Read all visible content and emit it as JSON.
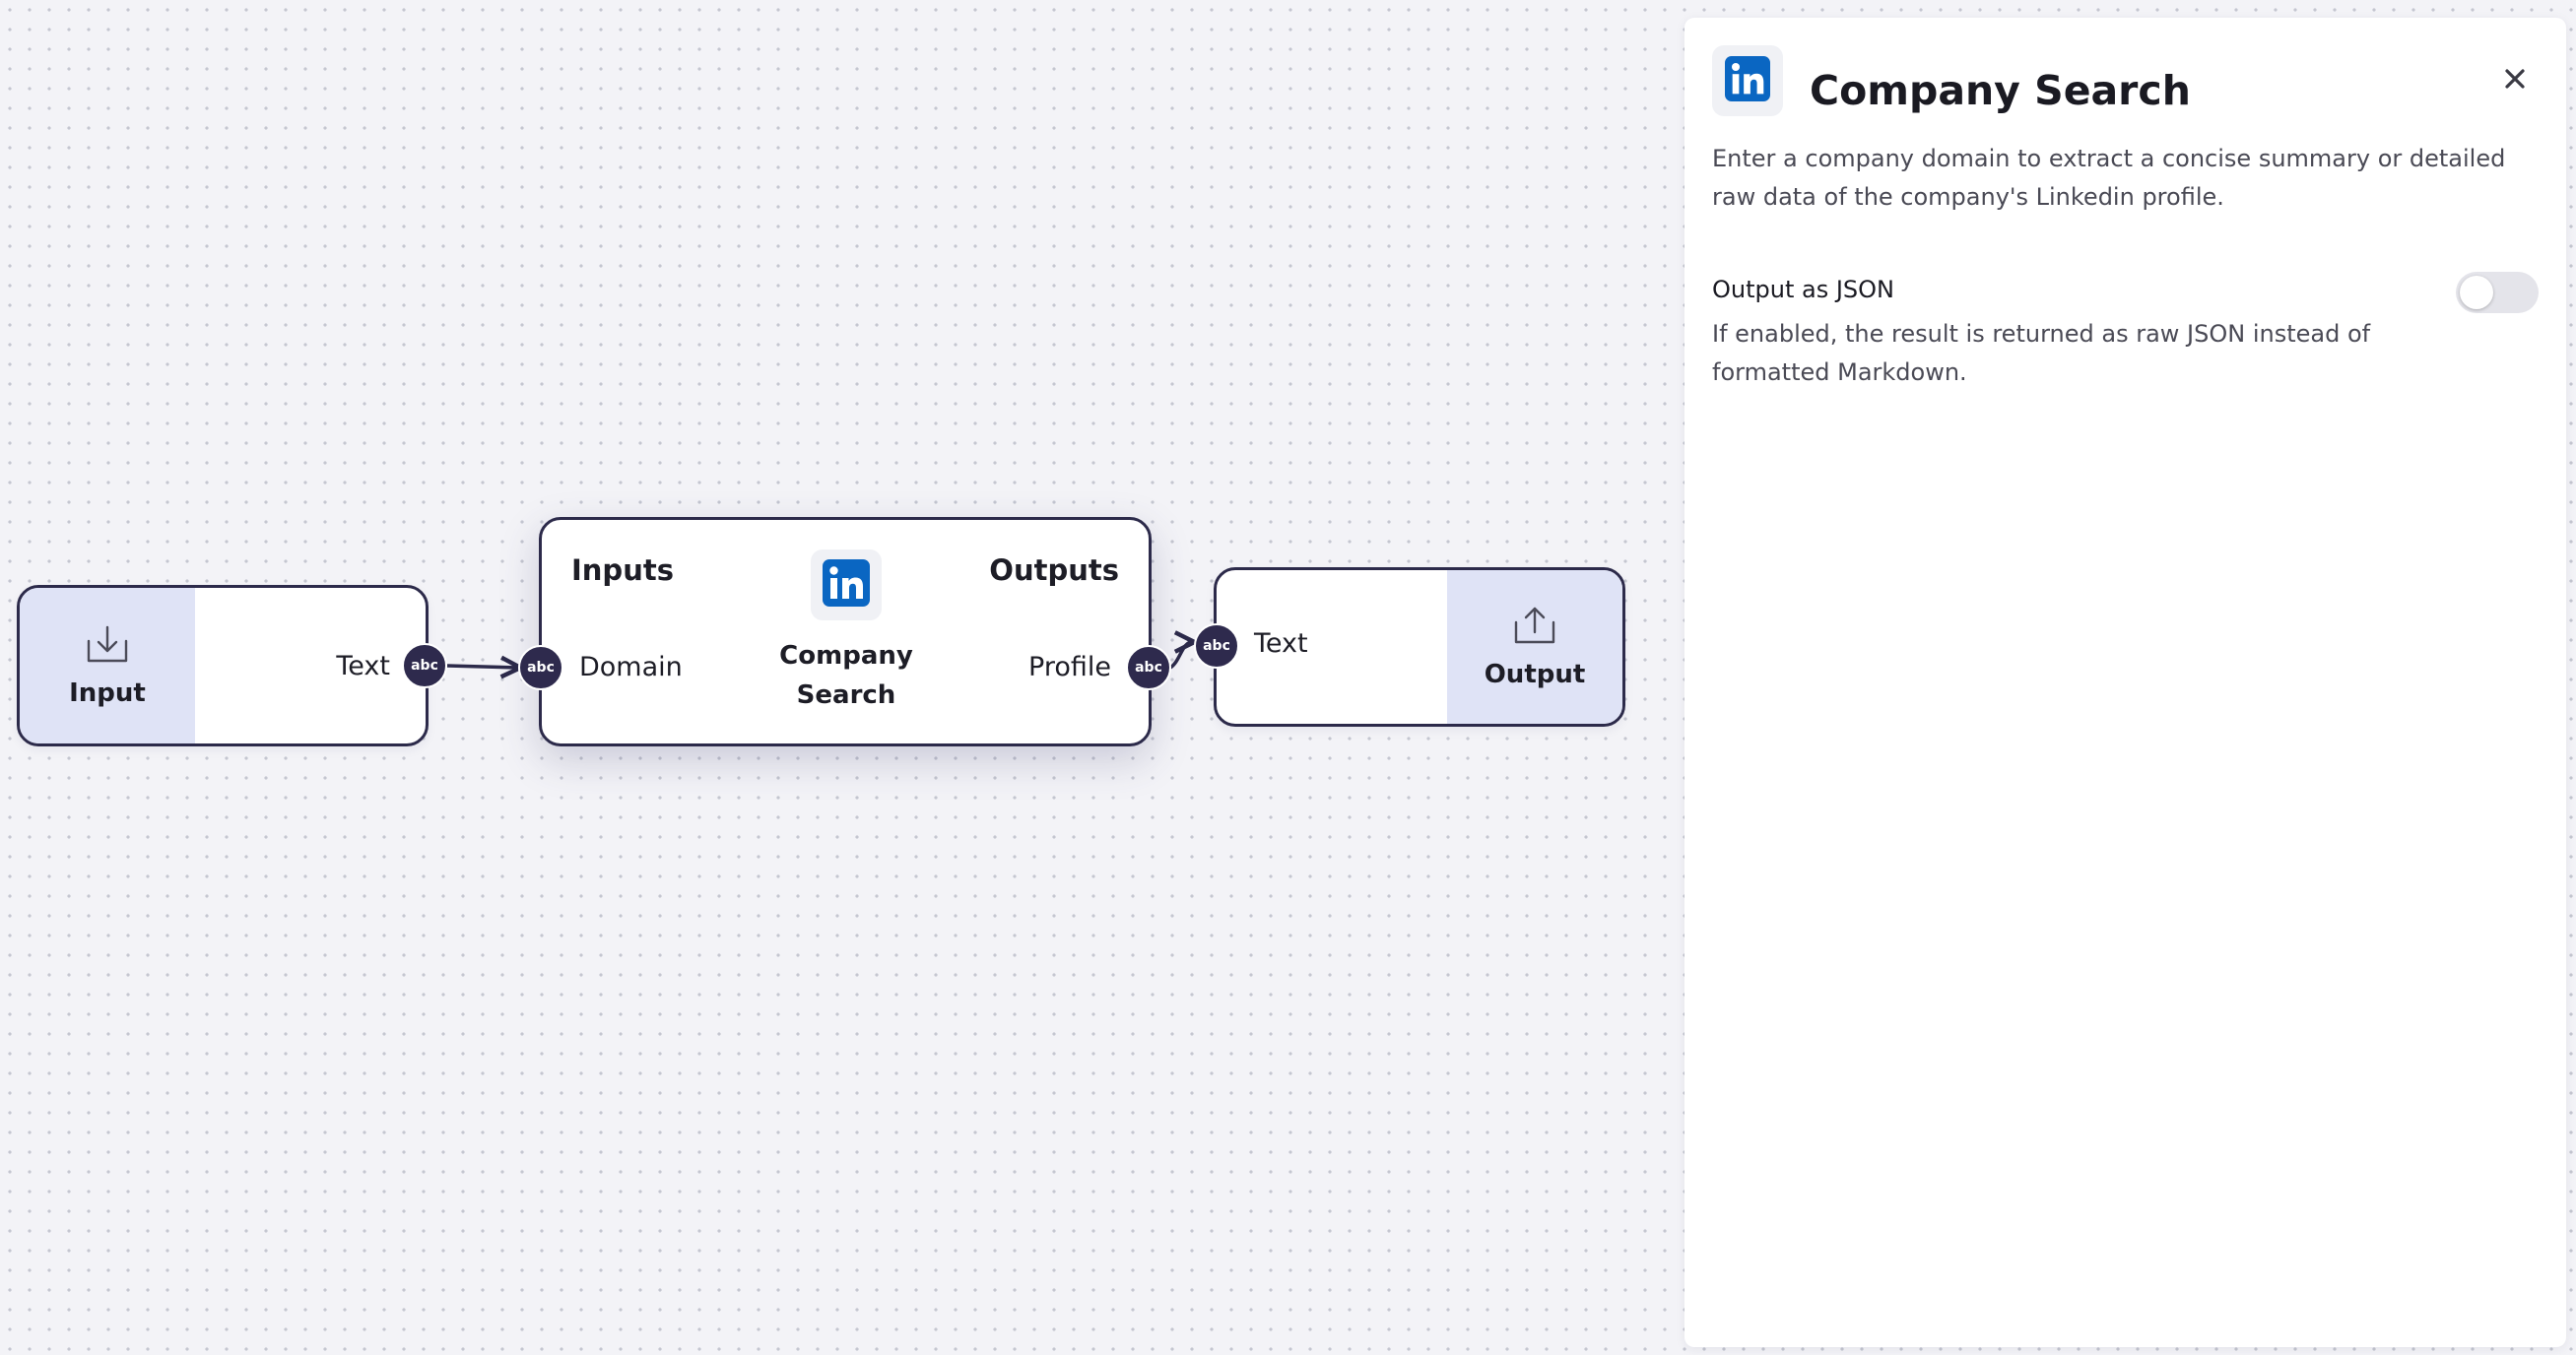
{
  "canvas": {
    "input_node": {
      "label": "Input",
      "port_label": "Text",
      "port_type": "abc",
      "icon": "download-tray-icon"
    },
    "company_search_node": {
      "inputs_title": "Inputs",
      "outputs_title": "Outputs",
      "title_line1": "Company",
      "title_line2": "Search",
      "input_port_label": "Domain",
      "output_port_label": "Profile",
      "port_type": "abc",
      "icon": "linkedin-icon"
    },
    "output_node": {
      "label": "Output",
      "port_label": "Text",
      "port_type": "abc",
      "icon": "upload-tray-icon"
    }
  },
  "panel": {
    "icon": "linkedin-icon",
    "title": "Company Search",
    "close_icon": "close-icon",
    "description": "Enter a company domain to extract a concise summary or detailed raw data of the company's Linkedin profile.",
    "setting": {
      "label": "Output as JSON",
      "help": "If enabled, the result is returned as raw JSON instead of formatted Markdown.",
      "enabled": false
    }
  },
  "colors": {
    "node_border": "#2c2a4a",
    "port_fill": "#2e2a4d",
    "io_fill": "#dfe3f6",
    "linkedin_blue": "#0a66c2",
    "canvas_bg": "#f3f3f7"
  }
}
